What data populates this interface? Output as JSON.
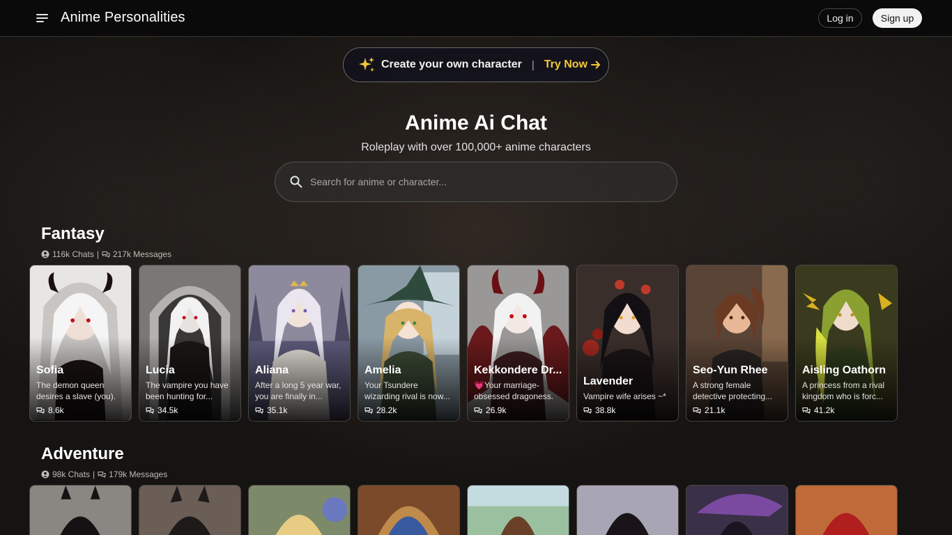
{
  "header": {
    "title": "Anime Personalities",
    "login_label": "Log in",
    "signup_label": "Sign up"
  },
  "create_banner": {
    "text": "Create your own character",
    "separator": "|",
    "cta": "Try Now"
  },
  "hero": {
    "title": "Anime Ai Chat",
    "subtitle": "Roleplay with over 100,000+ anime characters"
  },
  "search": {
    "placeholder": "Search for anime or character...",
    "value": ""
  },
  "sections": [
    {
      "title": "Fantasy",
      "chats": "116k Chats",
      "separator": "|",
      "messages": "217k Messages",
      "cards": [
        {
          "name": "Sofia",
          "desc": "The demon queen desires a slave (you).",
          "count": "8.6k"
        },
        {
          "name": "Lucia",
          "desc": "The vampire you have been hunting for...",
          "count": "34.5k"
        },
        {
          "name": "Aliana",
          "desc": "After a long 5 year war, you are finally in...",
          "count": "35.1k"
        },
        {
          "name": "Amelia",
          "desc": "Your Tsundere wizarding rival is now...",
          "count": "28.2k"
        },
        {
          "name": "Kekkondere Dr...",
          "desc": "💗Your marriage-obsessed dragoness.",
          "count": "26.9k"
        },
        {
          "name": "Lavender",
          "desc": "Vampire wife arises ~*",
          "count": "38.8k"
        },
        {
          "name": "Seo-Yun Rhee",
          "desc": "A strong female detective protecting...",
          "count": "21.1k"
        },
        {
          "name": "Aisling Oathorn",
          "desc": "A princess from a rival kingdom who is forc...",
          "count": "41.2k"
        }
      ]
    },
    {
      "title": "Adventure",
      "chats": "98k Chats",
      "separator": "|",
      "messages": "179k Messages"
    }
  ],
  "colors": {
    "accent": "#f5c83a",
    "header_bg": "#0b0a0a",
    "page_bg": "#161412"
  },
  "icons": {
    "menu": "menu-icon",
    "sparkle": "sparkle-icon",
    "arrow": "arrow-right-icon",
    "search": "search-icon",
    "user": "user-icon",
    "chat": "chat-icon"
  }
}
